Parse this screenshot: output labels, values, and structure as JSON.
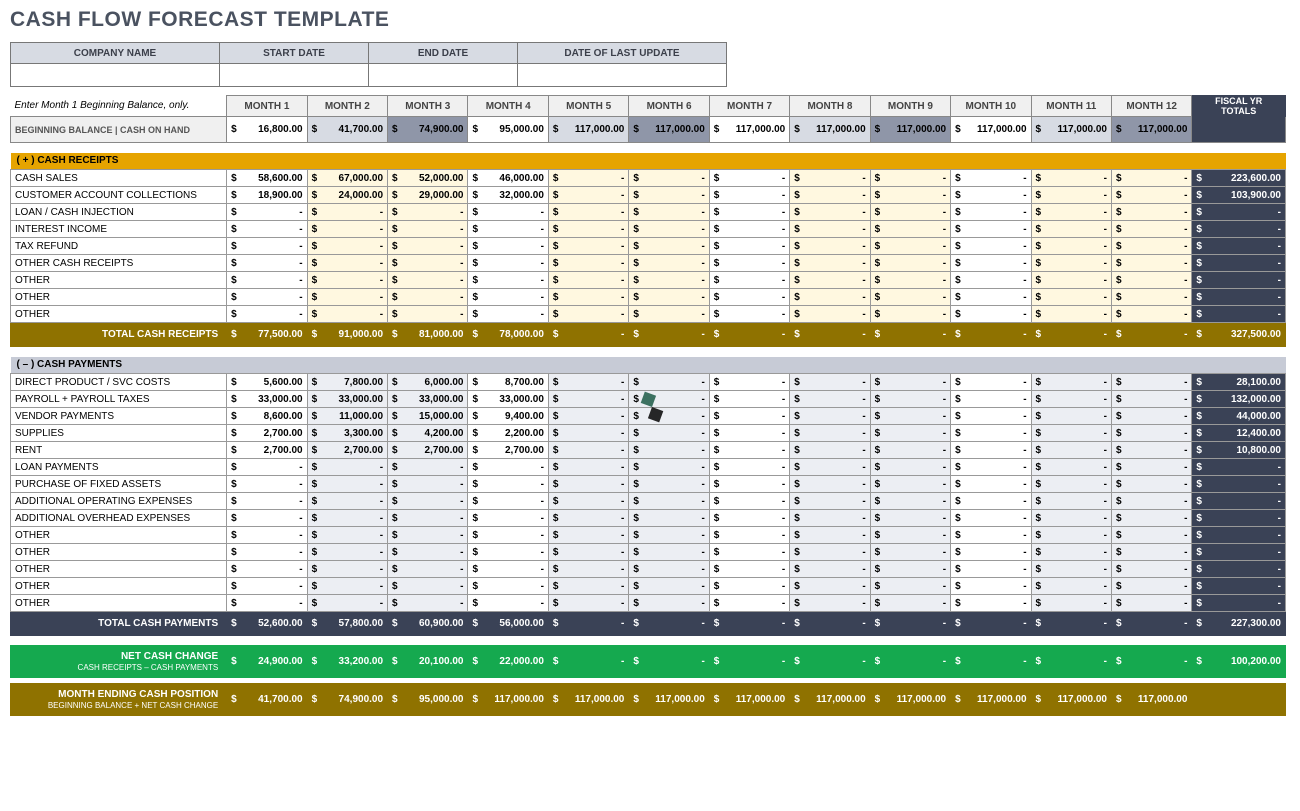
{
  "title": "CASH FLOW FORECAST TEMPLATE",
  "meta": {
    "headers": [
      "COMPANY NAME",
      "START DATE",
      "END DATE",
      "DATE OF LAST UPDATE"
    ],
    "values": [
      "",
      "",
      "",
      ""
    ]
  },
  "note": "Enter Month 1 Beginning Balance, only.",
  "months": [
    "MONTH 1",
    "MONTH 2",
    "MONTH 3",
    "MONTH 4",
    "MONTH 5",
    "MONTH 6",
    "MONTH 7",
    "MONTH 8",
    "MONTH 9",
    "MONTH 10",
    "MONTH 11",
    "MONTH 12"
  ],
  "totals_header": "FISCAL YR TOTALS",
  "beginning_label": "BEGINNING BALANCE  |  CASH ON HAND",
  "beginning": [
    "16,800.00",
    "41,700.00",
    "74,900.00",
    "95,000.00",
    "117,000.00",
    "117,000.00",
    "117,000.00",
    "117,000.00",
    "117,000.00",
    "117,000.00",
    "117,000.00",
    "117,000.00"
  ],
  "beginning_total": "",
  "receipts_header": "( + )   CASH RECEIPTS",
  "receipts": [
    {
      "label": "CASH SALES",
      "v": [
        "58,600.00",
        "67,000.00",
        "52,000.00",
        "46,000.00",
        "-",
        "-",
        "-",
        "-",
        "-",
        "-",
        "-",
        "-"
      ],
      "t": "223,600.00"
    },
    {
      "label": "CUSTOMER ACCOUNT COLLECTIONS",
      "v": [
        "18,900.00",
        "24,000.00",
        "29,000.00",
        "32,000.00",
        "-",
        "-",
        "-",
        "-",
        "-",
        "-",
        "-",
        "-"
      ],
      "t": "103,900.00"
    },
    {
      "label": "LOAN / CASH INJECTION",
      "v": [
        "-",
        "-",
        "-",
        "-",
        "-",
        "-",
        "-",
        "-",
        "-",
        "-",
        "-",
        "-"
      ],
      "t": "-"
    },
    {
      "label": "INTEREST INCOME",
      "v": [
        "-",
        "-",
        "-",
        "-",
        "-",
        "-",
        "-",
        "-",
        "-",
        "-",
        "-",
        "-"
      ],
      "t": "-"
    },
    {
      "label": "TAX REFUND",
      "v": [
        "-",
        "-",
        "-",
        "-",
        "-",
        "-",
        "-",
        "-",
        "-",
        "-",
        "-",
        "-"
      ],
      "t": "-"
    },
    {
      "label": "OTHER CASH RECEIPTS",
      "v": [
        "-",
        "-",
        "-",
        "-",
        "-",
        "-",
        "-",
        "-",
        "-",
        "-",
        "-",
        "-"
      ],
      "t": "-"
    },
    {
      "label": "OTHER",
      "v": [
        "-",
        "-",
        "-",
        "-",
        "-",
        "-",
        "-",
        "-",
        "-",
        "-",
        "-",
        "-"
      ],
      "t": "-"
    },
    {
      "label": "OTHER",
      "v": [
        "-",
        "-",
        "-",
        "-",
        "-",
        "-",
        "-",
        "-",
        "-",
        "-",
        "-",
        "-"
      ],
      "t": "-"
    },
    {
      "label": "OTHER",
      "v": [
        "-",
        "-",
        "-",
        "-",
        "-",
        "-",
        "-",
        "-",
        "-",
        "-",
        "-",
        "-"
      ],
      "t": "-"
    }
  ],
  "receipts_total_label": "TOTAL CASH RECEIPTS",
  "receipts_total": {
    "v": [
      "77,500.00",
      "91,000.00",
      "81,000.00",
      "78,000.00",
      "-",
      "-",
      "-",
      "-",
      "-",
      "-",
      "-",
      "-"
    ],
    "t": "327,500.00"
  },
  "payments_header": "( – )   CASH PAYMENTS",
  "payments": [
    {
      "label": "DIRECT PRODUCT / SVC COSTS",
      "v": [
        "5,600.00",
        "7,800.00",
        "6,000.00",
        "8,700.00",
        "-",
        "-",
        "-",
        "-",
        "-",
        "-",
        "-",
        "-"
      ],
      "t": "28,100.00"
    },
    {
      "label": "PAYROLL + PAYROLL TAXES",
      "v": [
        "33,000.00",
        "33,000.00",
        "33,000.00",
        "33,000.00",
        "-",
        "-",
        "-",
        "-",
        "-",
        "-",
        "-",
        "-"
      ],
      "t": "132,000.00"
    },
    {
      "label": "VENDOR PAYMENTS",
      "v": [
        "8,600.00",
        "11,000.00",
        "15,000.00",
        "9,400.00",
        "-",
        "-",
        "-",
        "-",
        "-",
        "-",
        "-",
        "-"
      ],
      "t": "44,000.00"
    },
    {
      "label": "SUPPLIES",
      "v": [
        "2,700.00",
        "3,300.00",
        "4,200.00",
        "2,200.00",
        "-",
        "-",
        "-",
        "-",
        "-",
        "-",
        "-",
        "-"
      ],
      "t": "12,400.00"
    },
    {
      "label": "RENT",
      "v": [
        "2,700.00",
        "2,700.00",
        "2,700.00",
        "2,700.00",
        "-",
        "-",
        "-",
        "-",
        "-",
        "-",
        "-",
        "-"
      ],
      "t": "10,800.00"
    },
    {
      "label": "LOAN PAYMENTS",
      "v": [
        "-",
        "-",
        "-",
        "-",
        "-",
        "-",
        "-",
        "-",
        "-",
        "-",
        "-",
        "-"
      ],
      "t": "-"
    },
    {
      "label": "PURCHASE OF FIXED ASSETS",
      "v": [
        "-",
        "-",
        "-",
        "-",
        "-",
        "-",
        "-",
        "-",
        "-",
        "-",
        "-",
        "-"
      ],
      "t": "-"
    },
    {
      "label": "ADDITIONAL OPERATING EXPENSES",
      "v": [
        "-",
        "-",
        "-",
        "-",
        "-",
        "-",
        "-",
        "-",
        "-",
        "-",
        "-",
        "-"
      ],
      "t": "-"
    },
    {
      "label": "ADDITIONAL OVERHEAD EXPENSES",
      "v": [
        "-",
        "-",
        "-",
        "-",
        "-",
        "-",
        "-",
        "-",
        "-",
        "-",
        "-",
        "-"
      ],
      "t": "-"
    },
    {
      "label": "OTHER",
      "v": [
        "-",
        "-",
        "-",
        "-",
        "-",
        "-",
        "-",
        "-",
        "-",
        "-",
        "-",
        "-"
      ],
      "t": "-"
    },
    {
      "label": "OTHER",
      "v": [
        "-",
        "-",
        "-",
        "-",
        "-",
        "-",
        "-",
        "-",
        "-",
        "-",
        "-",
        "-"
      ],
      "t": "-"
    },
    {
      "label": "OTHER",
      "v": [
        "-",
        "-",
        "-",
        "-",
        "-",
        "-",
        "-",
        "-",
        "-",
        "-",
        "-",
        "-"
      ],
      "t": "-"
    },
    {
      "label": "OTHER",
      "v": [
        "-",
        "-",
        "-",
        "-",
        "-",
        "-",
        "-",
        "-",
        "-",
        "-",
        "-",
        "-"
      ],
      "t": "-"
    },
    {
      "label": "OTHER",
      "v": [
        "-",
        "-",
        "-",
        "-",
        "-",
        "-",
        "-",
        "-",
        "-",
        "-",
        "-",
        "-"
      ],
      "t": "-"
    }
  ],
  "payments_total_label": "TOTAL CASH PAYMENTS",
  "payments_total": {
    "v": [
      "52,600.00",
      "57,800.00",
      "60,900.00",
      "56,000.00",
      "-",
      "-",
      "-",
      "-",
      "-",
      "-",
      "-",
      "-"
    ],
    "t": "227,300.00"
  },
  "net_label": "NET CASH CHANGE",
  "net_sub": "CASH RECEIPTS – CASH PAYMENTS",
  "net": {
    "v": [
      "24,900.00",
      "33,200.00",
      "20,100.00",
      "22,000.00",
      "-",
      "-",
      "-",
      "-",
      "-",
      "-",
      "-",
      "-"
    ],
    "t": "100,200.00"
  },
  "ending_label": "MONTH ENDING CASH POSITION",
  "ending_sub": "BEGINNING BALANCE + NET CASH CHANGE",
  "ending": {
    "v": [
      "41,700.00",
      "74,900.00",
      "95,000.00",
      "117,000.00",
      "117,000.00",
      "117,000.00",
      "117,000.00",
      "117,000.00",
      "117,000.00",
      "117,000.00",
      "117,000.00",
      "117,000.00"
    ],
    "t": ""
  }
}
